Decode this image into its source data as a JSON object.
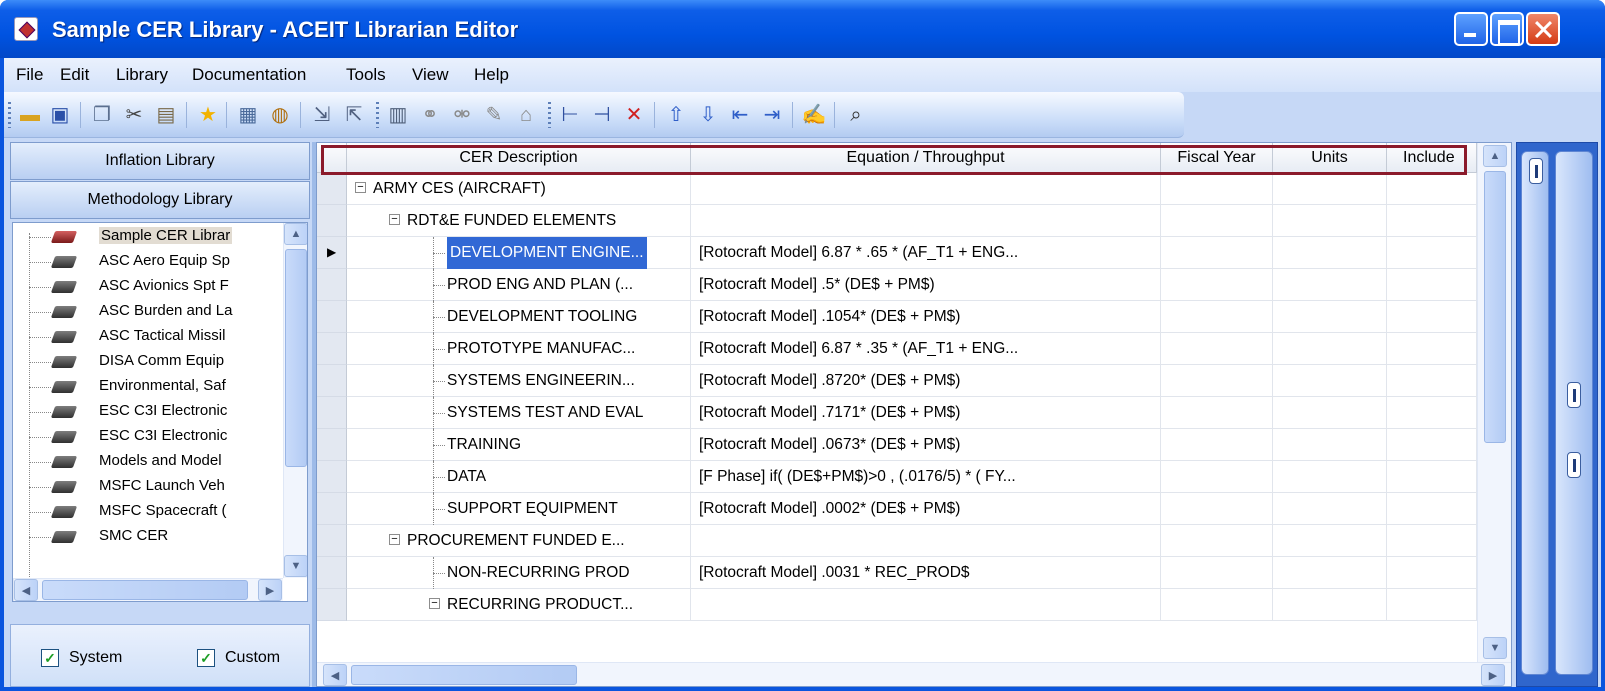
{
  "window": {
    "title": "Sample CER Library - ACEIT Librarian Editor"
  },
  "menu": [
    "File",
    "Edit",
    "Library",
    "Documentation",
    "Tools",
    "View",
    "Help"
  ],
  "toolbar_icons": [
    "open-folder-icon",
    "save-icon",
    "copy-icon",
    "cut-icon",
    "paste-icon",
    "favorite-star-icon",
    "properties-icon",
    "book-icon",
    "import-icon",
    "export-icon",
    "table-icon",
    "link-icon",
    "unlink-icon",
    "edit-icon",
    "home-icon",
    "add-child-icon",
    "add-sibling-icon",
    "delete-row-icon",
    "move-up-icon",
    "move-down-icon",
    "outdent-icon",
    "indent-icon",
    "report-icon",
    "find-icon"
  ],
  "left_panel": {
    "nav_buttons": [
      "Inflation Library",
      "Methodology Library"
    ],
    "tree_items": [
      "Sample CER Librar",
      "ASC Aero Equip Sp",
      "ASC Avionics Spt F",
      "ASC Burden and La",
      "ASC Tactical Missil",
      "DISA Comm Equip",
      "Environmental, Saf",
      "ESC C3I Electronic",
      "ESC C3I Electronic",
      "Models and Model",
      "MSFC Launch Veh",
      "MSFC Spacecraft (",
      "SMC CER"
    ],
    "checkboxes": [
      {
        "label": "System",
        "checked": true
      },
      {
        "label": "Custom",
        "checked": true
      }
    ]
  },
  "grid": {
    "columns": [
      "CER Description",
      "Equation / Throughput",
      "Fiscal Year",
      "Units",
      "Include"
    ],
    "rows": [
      {
        "level": 0,
        "toggle": "-",
        "desc": "ARMY CES (AIRCRAFT)",
        "eq": ""
      },
      {
        "level": 1,
        "toggle": "-",
        "desc": "RDT&E FUNDED ELEMENTS",
        "eq": ""
      },
      {
        "level": 2,
        "toggle": "",
        "desc": "DEVELOPMENT ENGINE...",
        "eq": "[Rotocraft Model] 6.87 * .65 * (AF_T1 + ENG...",
        "selected": true
      },
      {
        "level": 2,
        "toggle": "",
        "desc": "PROD ENG AND PLAN (...",
        "eq": "[Rotocraft Model] .5* (DE$ + PM$)"
      },
      {
        "level": 2,
        "toggle": "",
        "desc": "DEVELOPMENT TOOLING",
        "eq": "[Rotocraft Model] .1054* (DE$ + PM$)"
      },
      {
        "level": 2,
        "toggle": "",
        "desc": "PROTOTYPE MANUFAC...",
        "eq": "[Rotocraft Model] 6.87 * .35 * (AF_T1 + ENG..."
      },
      {
        "level": 2,
        "toggle": "",
        "desc": "SYSTEMS ENGINEERIN...",
        "eq": "[Rotocraft Model] .8720* (DE$ + PM$)"
      },
      {
        "level": 2,
        "toggle": "",
        "desc": "SYSTEMS TEST AND EVAL",
        "eq": "[Rotocraft Model] .7171* (DE$ + PM$)"
      },
      {
        "level": 2,
        "toggle": "",
        "desc": "TRAINING",
        "eq": "[Rotocraft Model] .0673* (DE$ + PM$)"
      },
      {
        "level": 2,
        "toggle": "",
        "desc": "DATA",
        "eq": "[F Phase] if( (DE$+PM$)>0 , (.0176/5) * ( FY..."
      },
      {
        "level": 2,
        "toggle": "",
        "desc": "SUPPORT EQUIPMENT",
        "eq": "[Rotocraft Model] .0002* (DE$ + PM$)"
      },
      {
        "level": 1,
        "toggle": "-",
        "desc": "PROCUREMENT FUNDED E...",
        "eq": ""
      },
      {
        "level": 2,
        "toggle": "",
        "desc": "NON-RECURRING PROD",
        "eq": "[Rotocraft Model] .0031 * REC_PROD$"
      },
      {
        "level": 2,
        "toggle": "-",
        "desc": "RECURRING PRODUCT...",
        "eq": ""
      }
    ]
  },
  "colors": {
    "titlebar": "#0053e1",
    "selection": "#3168d5",
    "header_highlight": "#8b1a2b"
  }
}
